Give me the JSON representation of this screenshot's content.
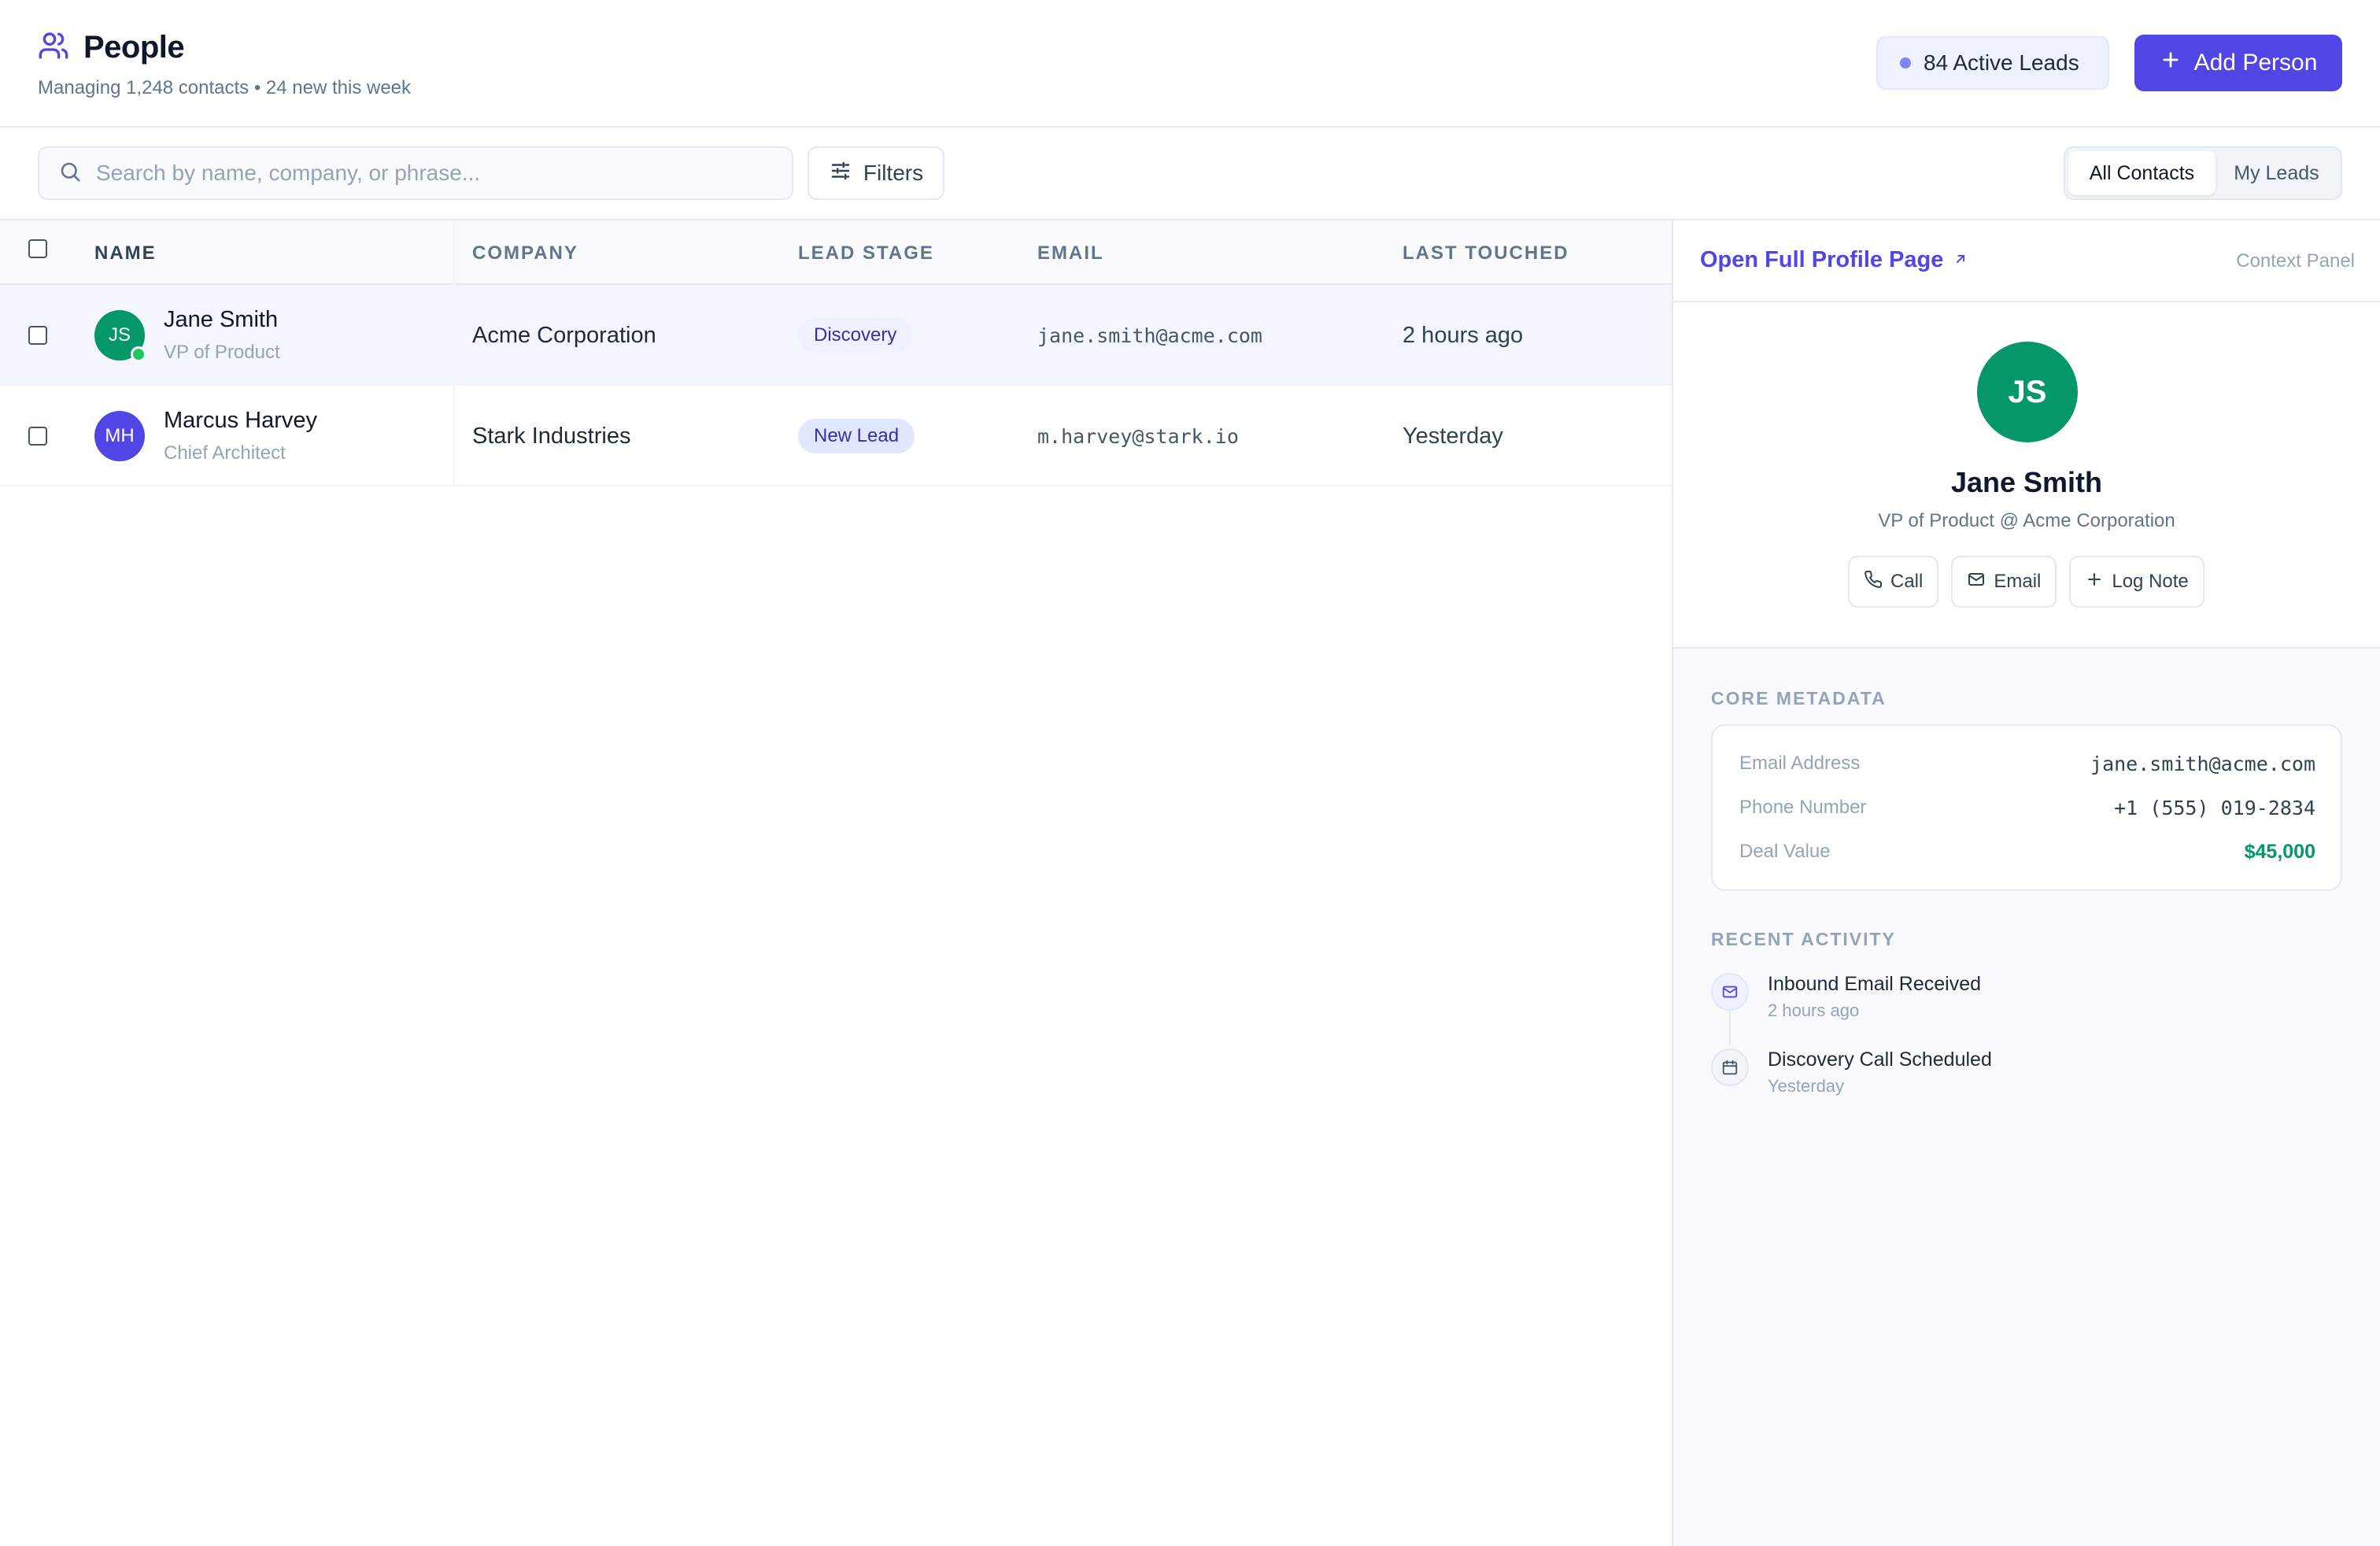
{
  "header": {
    "title": "People",
    "subtitle": "Managing 1,248 contacts • 24 new this week",
    "leads_badge": "84 Active Leads",
    "add_button": "Add Person"
  },
  "toolbar": {
    "search_placeholder": "Search by name, company, or phrase...",
    "filters_label": "Filters",
    "segments": [
      "All Contacts",
      "My Leads"
    ]
  },
  "table": {
    "columns": [
      "Name",
      "Company",
      "Lead Stage",
      "Email",
      "Last Touched"
    ],
    "rows": [
      {
        "initials": "JS",
        "name": "Jane Smith",
        "role": "VP of Product",
        "company": "Acme Corporation",
        "stage": "Discovery",
        "email": "jane.smith@acme.com",
        "last_touched": "2 hours ago",
        "avatar_color": "#059669"
      },
      {
        "initials": "MH",
        "name": "Marcus Harvey",
        "role": "Chief Architect",
        "company": "Stark Industries",
        "stage": "New Lead",
        "email": "m.harvey@stark.io",
        "last_touched": "Yesterday",
        "avatar_color": "#4f46e5"
      }
    ]
  },
  "panel": {
    "open_link": "Open Full Profile Page",
    "context_label": "Context Panel",
    "initials": "JS",
    "name": "Jane Smith",
    "role": "VP of Product @ Acme Corporation",
    "actions": [
      "Call",
      "Email",
      "Log Note"
    ],
    "core_metadata_title": "Core Metadata",
    "metadata": [
      {
        "label": "Email Address",
        "value": "jane.smith@acme.com"
      },
      {
        "label": "Phone Number",
        "value": "+1 (555) 019-2834"
      },
      {
        "label": "Deal Value",
        "value": "$45,000"
      }
    ],
    "recent_activity_title": "Recent Activity",
    "activity": [
      {
        "icon": "mail-icon",
        "title": "Inbound Email Received",
        "time": "2 hours ago"
      },
      {
        "icon": "calendar-icon",
        "title": "Discovery Call Scheduled",
        "time": "Yesterday"
      }
    ]
  },
  "colors": {
    "accent": "#4f46e5",
    "success": "#059669",
    "online": "#22c55e"
  }
}
